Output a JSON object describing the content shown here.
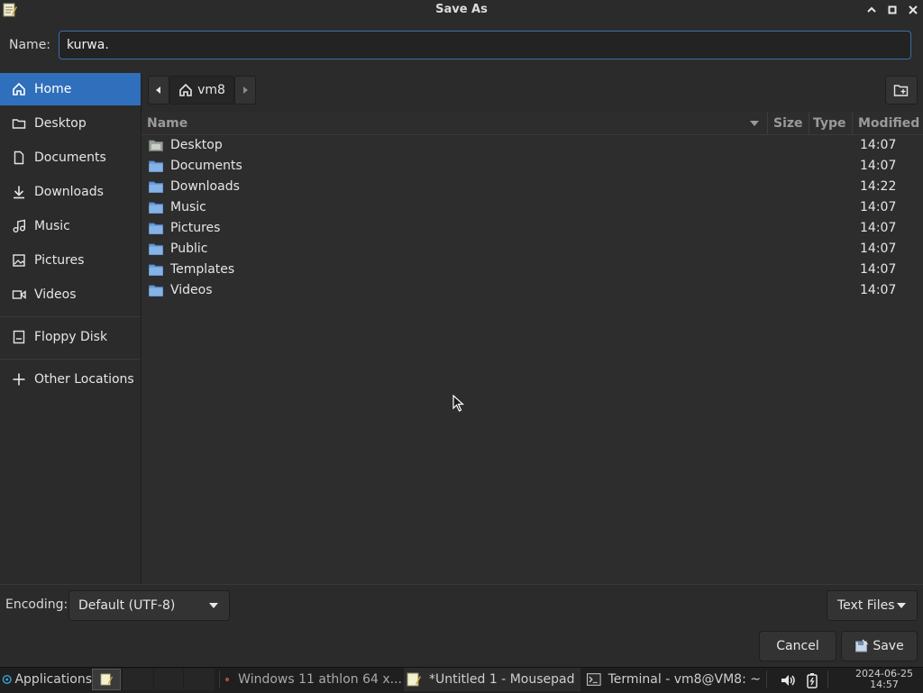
{
  "window": {
    "title": "Save As"
  },
  "name_row": {
    "label": "Name:",
    "value": "kurwa."
  },
  "sidebar": {
    "items": [
      {
        "label": "Home",
        "icon": "home-icon",
        "active": true
      },
      {
        "label": "Desktop",
        "icon": "folder-icon"
      },
      {
        "label": "Documents",
        "icon": "document-icon"
      },
      {
        "label": "Downloads",
        "icon": "download-icon"
      },
      {
        "label": "Music",
        "icon": "music-icon"
      },
      {
        "label": "Pictures",
        "icon": "picture-icon"
      },
      {
        "label": "Videos",
        "icon": "video-icon"
      },
      {
        "label": "Floppy Disk",
        "icon": "floppy-icon"
      },
      {
        "label": "Other Locations",
        "icon": "plus-icon"
      }
    ]
  },
  "path_bar": {
    "current": "vm8"
  },
  "file_list": {
    "columns": [
      "Name",
      "Size",
      "Type",
      "Modified"
    ],
    "rows": [
      {
        "name": "Desktop",
        "modified": "14:07",
        "icon": "desktop-folder-icon"
      },
      {
        "name": "Documents",
        "modified": "14:07",
        "icon": "folder-icon"
      },
      {
        "name": "Downloads",
        "modified": "14:22",
        "icon": "folder-icon"
      },
      {
        "name": "Music",
        "modified": "14:07",
        "icon": "folder-icon"
      },
      {
        "name": "Pictures",
        "modified": "14:07",
        "icon": "folder-icon"
      },
      {
        "name": "Public",
        "modified": "14:07",
        "icon": "folder-icon"
      },
      {
        "name": "Templates",
        "modified": "14:07",
        "icon": "folder-icon"
      },
      {
        "name": "Videos",
        "modified": "14:07",
        "icon": "folder-icon"
      }
    ]
  },
  "encoding": {
    "label": "Encoding:",
    "value": "Default (UTF-8)"
  },
  "filter": {
    "value": "Text Files"
  },
  "buttons": {
    "cancel": "Cancel",
    "save": "Save"
  },
  "taskbar": {
    "applications": "Applications",
    "tasks": [
      "Windows 11 athlon 64 x...",
      "*Untitled 1 - Mousepad",
      "Terminal - vm8@VM8: ~"
    ],
    "date": "2024-06-25",
    "time": "14:57"
  },
  "colors": {
    "accent": "#2f6fbb",
    "background": "#2b2b2b",
    "folder": "#6d9fd8"
  }
}
